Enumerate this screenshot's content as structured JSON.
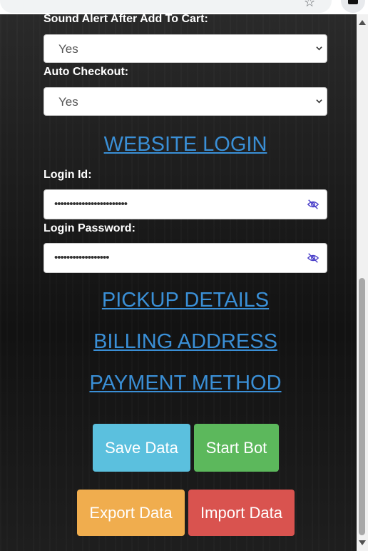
{
  "browser": {
    "star_icon": "star-icon",
    "extension_icon": "extension-icon"
  },
  "form": {
    "sound_alert": {
      "label": "Sound Alert After Add To Cart:",
      "value": "Yes"
    },
    "auto_checkout": {
      "label": "Auto Checkout:",
      "value": "Yes"
    },
    "website_login_heading": "WEBSITE LOGIN",
    "login_id": {
      "label": "Login Id:",
      "value": "••••••••••••••••••••••••"
    },
    "login_password": {
      "label": "Login Password:",
      "value": "••••••••••••••••••"
    },
    "pickup_details_heading": "PICKUP DETAILS",
    "billing_address_heading": "BILLING ADDRESS",
    "payment_method_heading": "PAYMENT METHOD"
  },
  "buttons": {
    "save": {
      "label": "Save Data",
      "color": "#5bc0de"
    },
    "start": {
      "label": "Start Bot",
      "color": "#5cb85c"
    },
    "export": {
      "label": "Export Data",
      "color": "#f0ad4e"
    },
    "import": {
      "label": "Import Data",
      "color": "#d9534f"
    }
  },
  "colors": {
    "heading_link": "#3a8fd6",
    "eye_icon": "#4a3fc9"
  }
}
